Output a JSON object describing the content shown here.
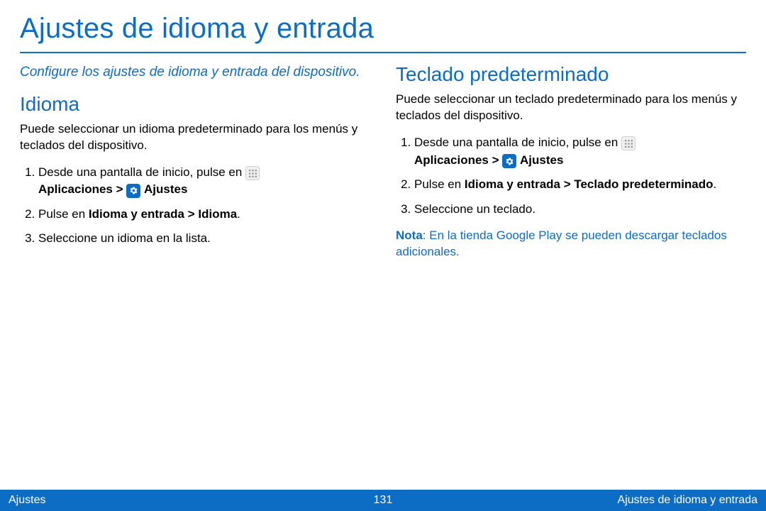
{
  "page": {
    "title": "Ajustes de idioma y entrada",
    "intro": "Configure los ajustes de idioma y entrada del dispositivo."
  },
  "left": {
    "heading": "Idioma",
    "desc": "Puede seleccionar un idioma predeterminado para los menús y teclados del dispositivo.",
    "step1_a": "Desde una pantalla de inicio, pulse en ",
    "step1_b": "Aplicaciones > ",
    "step1_c": " Ajustes",
    "step2_a": "Pulse en ",
    "step2_b": "Idioma y entrada > Idioma",
    "step2_c": ".",
    "step3": "Seleccione un idioma en la lista."
  },
  "right": {
    "heading": "Teclado predeterminado",
    "desc": "Puede seleccionar un teclado predeterminado para los menús y teclados del dispositivo.",
    "step1_a": "Desde una pantalla de inicio, pulse en ",
    "step1_b": "Aplicaciones > ",
    "step1_c": " Ajustes",
    "step2_a": "Pulse en ",
    "step2_b": "Idioma y entrada > Teclado predeterminado",
    "step2_c": ".",
    "step3": "Seleccione un teclado.",
    "note_label": "Nota",
    "note_text": ": En la tienda Google Play se pueden descargar teclados adicionales."
  },
  "footer": {
    "left": "Ajustes",
    "center": "131",
    "right": "Ajustes de idioma y entrada"
  },
  "icons": {
    "apps": "apps-grid-icon",
    "gear": "settings-gear-icon"
  }
}
